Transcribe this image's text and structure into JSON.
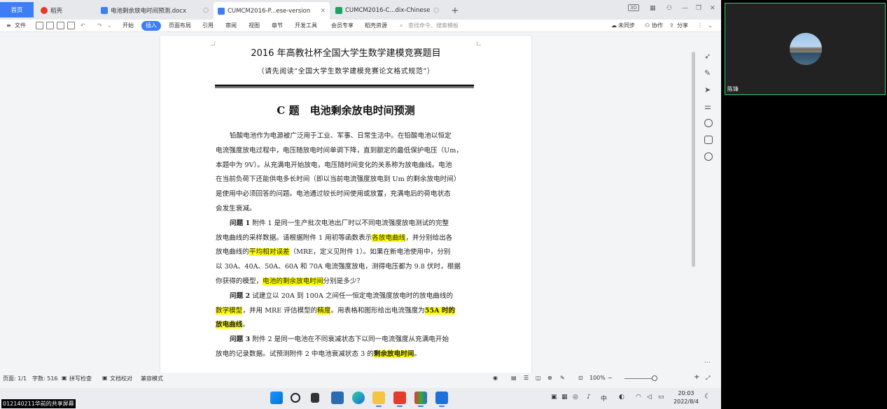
{
  "tabs": {
    "home": "首页",
    "wps": "稻壳",
    "doc1": "电池剩余放电时间预测.docx",
    "doc2": "CUMCM2016-P...ese-version",
    "doc3": "CUMCM2016-C...dix-Chinese",
    "add": "+"
  },
  "titlebar_right": {
    "badge": "3D"
  },
  "ribbon": {
    "file": "文件",
    "start": "开始",
    "insert": "插入",
    "layout": "页面布局",
    "reference": "引用",
    "review": "审阅",
    "view": "视图",
    "chapter": "章节",
    "devtools": "开发工具",
    "member": "会员专享",
    "docer": "稻壳资源",
    "search_placeholder": "查找命令、搜索模板",
    "unsync": "未同步",
    "collab": "协作",
    "share": "分享"
  },
  "document": {
    "title": "2016 年高教社杯全国大学生数学建模竞赛题目",
    "subtitle": "（请先阅读“全国大学生数学建模竞赛论文格式规范”）",
    "problem_heading": "C 题　电池剩余放电时间预测",
    "p1": [
      "铅酸电池作为电源被广泛用于工业、军事、日常生活中。在铅酸电池以恒定",
      "电流强度放电过程中，电压随放电时间单调下降，直到额定的最低保护电压（Um，",
      "本题中为 9V）。从充满电开始放电，电压随时间变化的关系称为放电曲线。电池",
      "在当前负荷下还能供电多长时间（即以当前电流强度放电到 Um 的剩余放电时间）",
      "是使用中必须回答的问题。电池通过较长时间使用或放置，充满电后的荷电状态",
      "会发生衰减。"
    ],
    "q1": {
      "label": "问题 1",
      "l1": "附件 1 是同一生产批次电池出厂时以不同电流强度放电测试的完整",
      "l2a": "放电曲线的采样数据。请根据附件 1 用初等函数表示",
      "l2hl": "各放电曲线",
      "l2b": "，并分别给出各",
      "l3a": "放电曲线的",
      "l3hl": "平均相对误差",
      "l3b": "（MRE，定义见附件 1）。如果在新电池使用中，分别",
      "l4": "以 30A、40A、50A、60A 和 70A 电流强度放电，测得电压都为 9.8 伏时，根据",
      "l5a": "你获得的模型，",
      "l5hl": "电池的剩余放电时间",
      "l5b": "分别是多少？"
    },
    "q2": {
      "label": "问题 2",
      "l1": "试建立以 20A 到 100A 之间任一恒定电流强度放电时的放电曲线的",
      "l2hl1": "数学模型",
      "l2a": "，并用 MRE 评估模型的",
      "l2hl2": "精度",
      "l2b": "。用表格和图形给出电流强度为",
      "l2hl3": "55A 时的",
      "l3hl": "放电曲线",
      "l3b": "。"
    },
    "q3": {
      "label": "问题 3",
      "l1": "附件 2 是同一电池在不同衰减状态下以同一电流强度从充满电开始",
      "l2a": "放电的记录数据。试预测附件 2 中电池衰减状态 3 的",
      "l2hl": "剩余放电时间",
      "l2b": "。"
    }
  },
  "statusbar": {
    "page": "页面: 1/1",
    "words": "字数: 516",
    "spell": "拼写检查",
    "proof": "文档校对",
    "compat": "兼容模式",
    "zoom": "100%"
  },
  "taskbar": {
    "time": "20:03",
    "date": "2022/8/4"
  },
  "video": {
    "name": "陈锋"
  },
  "share_label": "012140211华前的共享屏幕",
  "colors": {
    "accent": "#3d7ef6",
    "highlight": "#ffff00",
    "video_border": "#2ecc71"
  }
}
